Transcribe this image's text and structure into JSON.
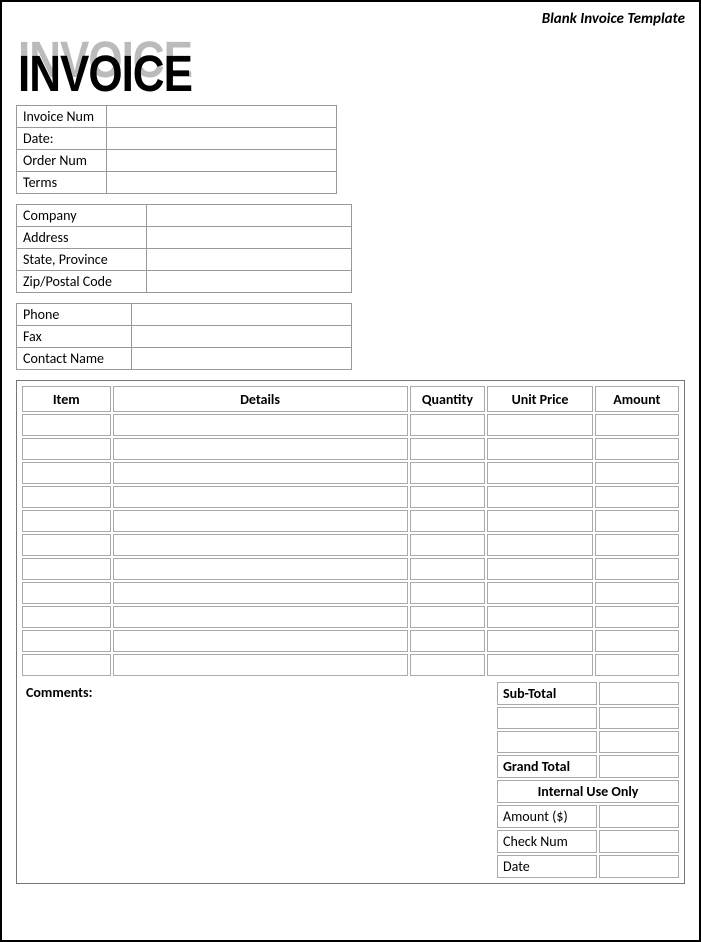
{
  "header_label": "Blank Invoice Template",
  "logo_text": "INVOICE",
  "info1": {
    "rows": [
      {
        "label": "Invoice Num",
        "value": ""
      },
      {
        "label": "Date:",
        "value": ""
      },
      {
        "label": "Order Num",
        "value": ""
      },
      {
        "label": "Terms",
        "value": ""
      }
    ]
  },
  "info2": {
    "rows": [
      {
        "label": "Company",
        "value": ""
      },
      {
        "label": "Address",
        "value": ""
      },
      {
        "label": "State, Province",
        "value": ""
      },
      {
        "label": "Zip/Postal Code",
        "value": ""
      }
    ]
  },
  "info3": {
    "rows": [
      {
        "label": "Phone",
        "value": ""
      },
      {
        "label": "Fax",
        "value": ""
      },
      {
        "label": "Contact Name",
        "value": ""
      }
    ]
  },
  "items": {
    "headers": {
      "item": "Item",
      "details": "Details",
      "qty": "Quantity",
      "price": "Unit Price",
      "amount": "Amount"
    },
    "rows": [
      {
        "item": "",
        "details": "",
        "qty": "",
        "price": "",
        "amount": ""
      },
      {
        "item": "",
        "details": "",
        "qty": "",
        "price": "",
        "amount": ""
      },
      {
        "item": "",
        "details": "",
        "qty": "",
        "price": "",
        "amount": ""
      },
      {
        "item": "",
        "details": "",
        "qty": "",
        "price": "",
        "amount": ""
      },
      {
        "item": "",
        "details": "",
        "qty": "",
        "price": "",
        "amount": ""
      },
      {
        "item": "",
        "details": "",
        "qty": "",
        "price": "",
        "amount": ""
      },
      {
        "item": "",
        "details": "",
        "qty": "",
        "price": "",
        "amount": ""
      },
      {
        "item": "",
        "details": "",
        "qty": "",
        "price": "",
        "amount": ""
      },
      {
        "item": "",
        "details": "",
        "qty": "",
        "price": "",
        "amount": ""
      },
      {
        "item": "",
        "details": "",
        "qty": "",
        "price": "",
        "amount": ""
      },
      {
        "item": "",
        "details": "",
        "qty": "",
        "price": "",
        "amount": ""
      }
    ]
  },
  "comments_label": "Comments:",
  "totals": {
    "subtotal_label": "Sub-Total",
    "subtotal_value": "",
    "extra": [
      {
        "label": "",
        "value": ""
      },
      {
        "label": "",
        "value": ""
      }
    ],
    "grand_label": "Grand Total",
    "grand_value": "",
    "internal_header": "Internal Use Only",
    "internal": [
      {
        "label": "Amount ($)",
        "value": ""
      },
      {
        "label": "Check Num",
        "value": ""
      },
      {
        "label": "Date",
        "value": ""
      }
    ]
  }
}
